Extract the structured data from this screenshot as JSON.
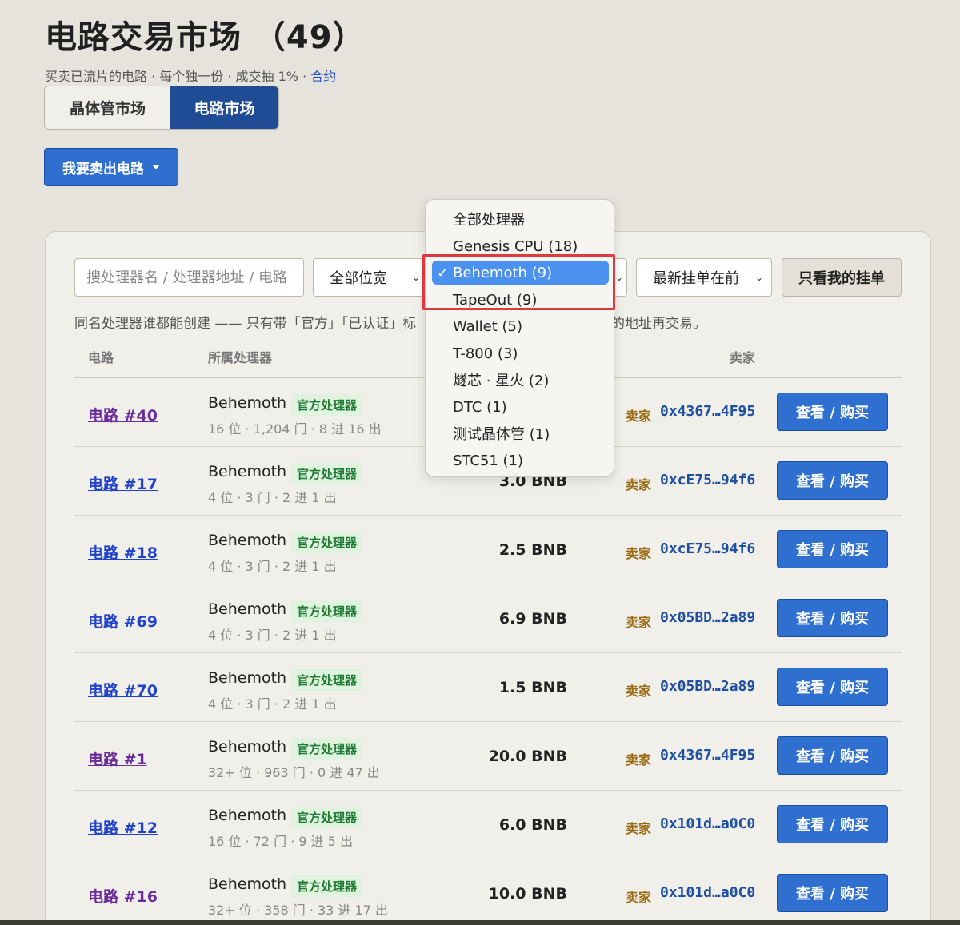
{
  "header": {
    "title": "电路交易市场 （49）",
    "subtitle": "买卖已流片的电路 · 每个独一份 · 成交抽 1% · ",
    "contract_link": "合约"
  },
  "market_tabs": [
    {
      "label": "晶体管市场",
      "active": false
    },
    {
      "label": "电路市场",
      "active": true
    }
  ],
  "sell_button": "我要卖出电路",
  "filters": {
    "search_placeholder": "搜处理器名 / 处理器地址 / 电路",
    "width_select": "全部位宽",
    "sort_select": "最新挂单在前",
    "mine_button": "只看我的挂单"
  },
  "notice": "同名处理器谁都能创建 —— 只有带「官方」「已认证」标",
  "notice_tail": "的地址再交易。",
  "table_headers": {
    "circuit": "电路",
    "processor": "所属处理器",
    "seller": "卖家"
  },
  "rows": [
    {
      "id": "电路 #40",
      "proc": "Behemoth",
      "badge": "官方处理器",
      "meta": "16 位 · 1,204 门 · 8 进 16 出",
      "price": "",
      "seller_label": "卖家",
      "seller": "0x4367…4F95",
      "action": "查看 / 购买"
    },
    {
      "id": "电路 #17",
      "proc": "Behemoth",
      "badge": "官方处理器",
      "meta": "4 位 · 3 门 · 2 进 1 出",
      "price": "3.0 BNB",
      "seller_label": "卖家",
      "seller": "0xcE75…94f6",
      "action": "查看 / 购买"
    },
    {
      "id": "电路 #18",
      "proc": "Behemoth",
      "badge": "官方处理器",
      "meta": "4 位 · 3 门 · 2 进 1 出",
      "price": "2.5 BNB",
      "seller_label": "卖家",
      "seller": "0xcE75…94f6",
      "action": "查看 / 购买"
    },
    {
      "id": "电路 #69",
      "proc": "Behemoth",
      "badge": "官方处理器",
      "meta": "4 位 · 3 门 · 2 进 1 出",
      "price": "6.9 BNB",
      "seller_label": "卖家",
      "seller": "0x05BD…2a89",
      "action": "查看 / 购买"
    },
    {
      "id": "电路 #70",
      "proc": "Behemoth",
      "badge": "官方处理器",
      "meta": "4 位 · 3 门 · 2 进 1 出",
      "price": "1.5 BNB",
      "seller_label": "卖家",
      "seller": "0x05BD…2a89",
      "action": "查看 / 购买"
    },
    {
      "id": "电路 #1",
      "proc": "Behemoth",
      "badge": "官方处理器",
      "meta": "32+ 位 · 963 门 · 0 进 47 出",
      "price": "20.0 BNB",
      "seller_label": "卖家",
      "seller": "0x4367…4F95",
      "action": "查看 / 购买"
    },
    {
      "id": "电路 #12",
      "proc": "Behemoth",
      "badge": "官方处理器",
      "meta": "16 位 · 72 门 · 9 进 5 出",
      "price": "6.0 BNB",
      "seller_label": "卖家",
      "seller": "0x101d…a0C0",
      "action": "查看 / 购买"
    },
    {
      "id": "电路 #16",
      "proc": "Behemoth",
      "badge": "官方处理器",
      "meta": "32+ 位 · 358 门 · 33 进 17 出",
      "price": "10.0 BNB",
      "seller_label": "卖家",
      "seller": "0x101d…a0C0",
      "action": "查看 / 购买"
    }
  ],
  "processor_dropdown": {
    "selected": "Behemoth (9)",
    "options": [
      "全部处理器",
      "Genesis CPU (18)",
      "Behemoth (9)",
      "TapeOut (9)",
      "Wallet (5)",
      "T-800 (3)",
      "燧芯 · 星火 (2)",
      "DTC (1)",
      "测试晶体管 (1)",
      "STC51 (1)"
    ]
  },
  "colors": {
    "primary_button": "#2f6fd0",
    "active_tab": "#1f4c94",
    "link": "#2244cc",
    "badge_bg": "#dff3df",
    "badge_text": "#1f7a34",
    "seller_label": "#9a6a10",
    "highlight": "#e0383e"
  }
}
